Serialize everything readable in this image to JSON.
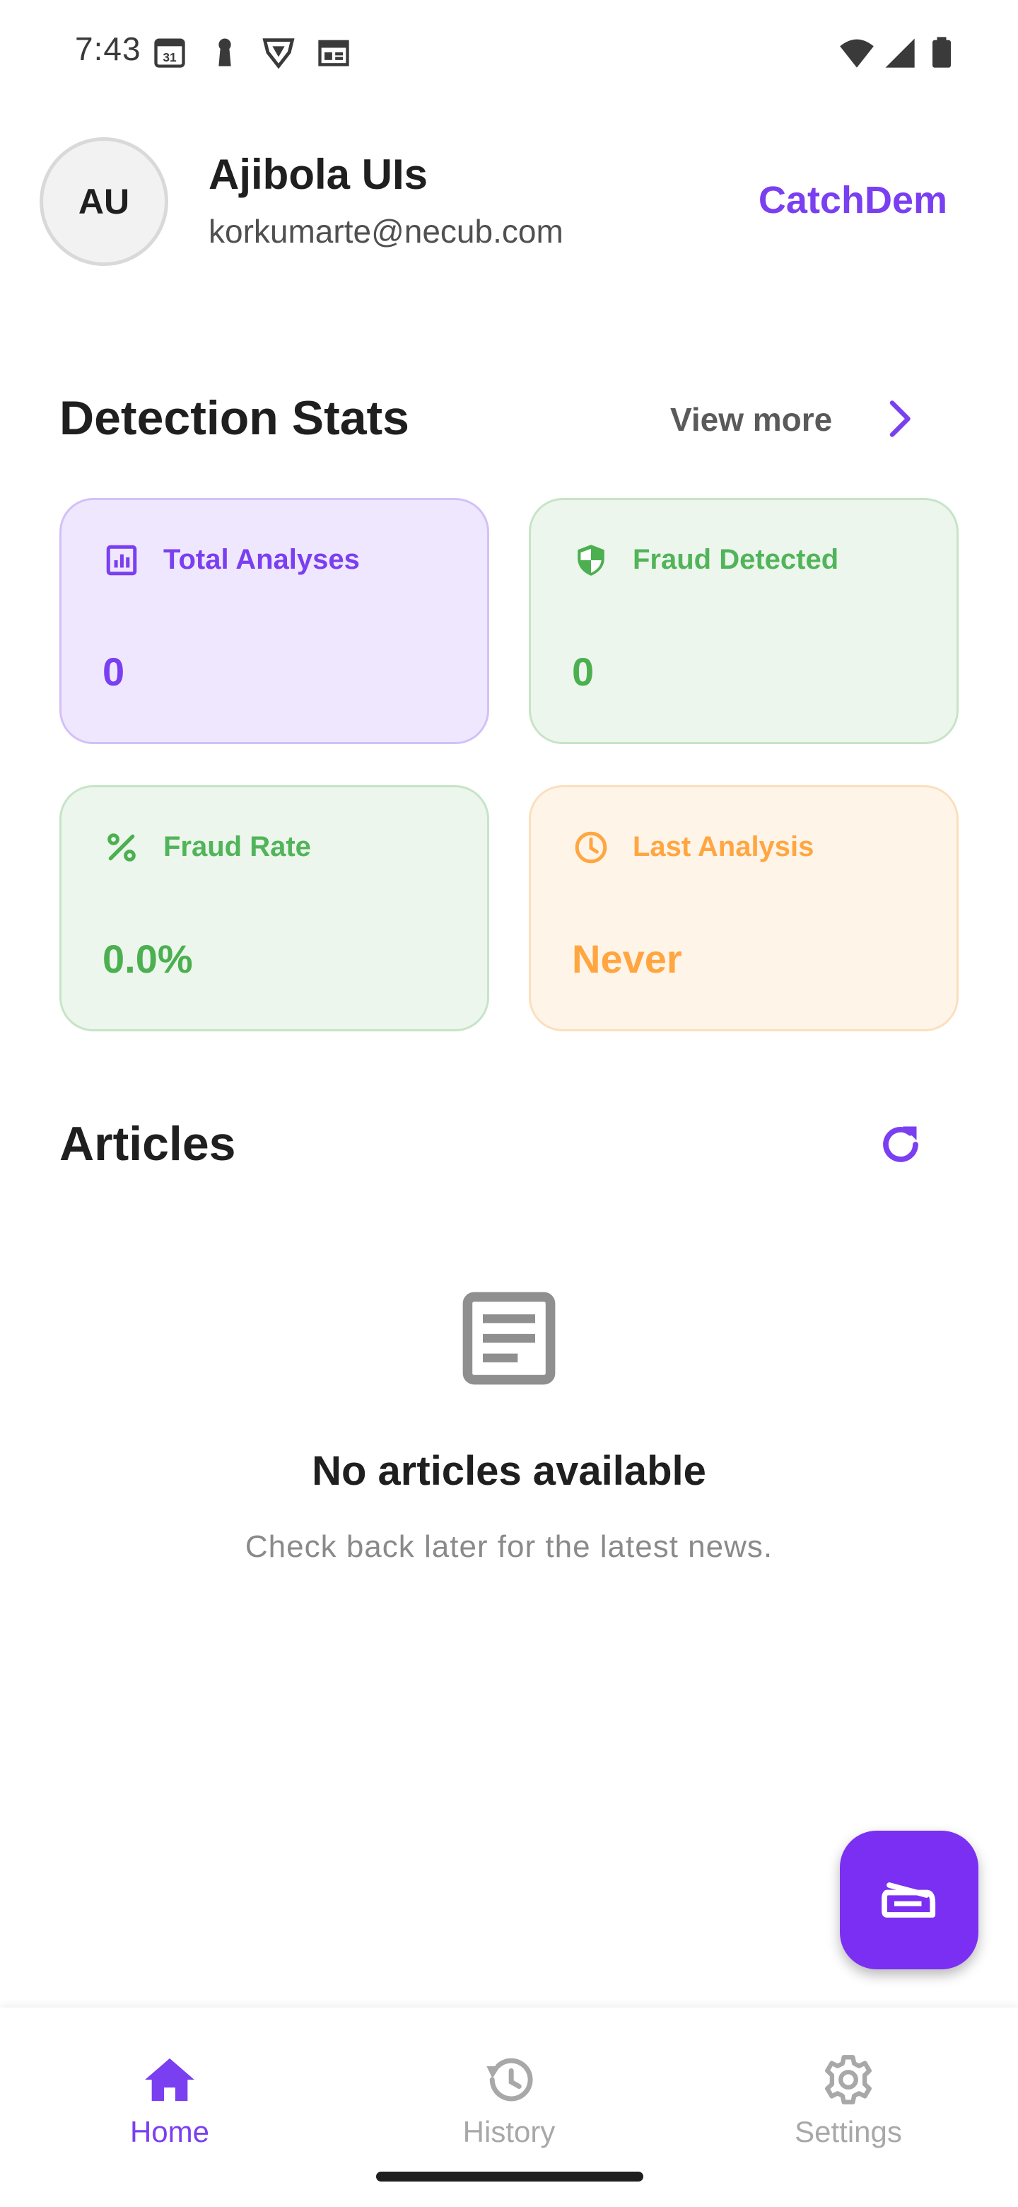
{
  "status_bar": {
    "time": "7:43",
    "left_icons": [
      "calendar-31-icon",
      "keyhole-icon",
      "vpn-shield-icon",
      "news-icon"
    ],
    "right_icons": [
      "wifi-icon",
      "signal-icon",
      "battery-icon"
    ]
  },
  "header": {
    "avatar_initials": "AU",
    "user_name": "Ajibola UIs",
    "user_email": "korkumarte@necub.com",
    "brand": "CatchDem"
  },
  "stats": {
    "title": "Detection Stats",
    "view_more": "View more",
    "cards": [
      {
        "label": "Total Analyses",
        "value": "0",
        "icon": "bar-chart-icon",
        "color": "#7a3ff0"
      },
      {
        "label": "Fraud Detected",
        "value": "0",
        "icon": "shield-icon",
        "color": "#4caf50"
      },
      {
        "label": "Fraud Rate",
        "value": "0.0%",
        "icon": "percent-icon",
        "color": "#4caf50"
      },
      {
        "label": "Last Analysis",
        "value": "Never",
        "icon": "clock-icon",
        "color": "#ffa640"
      }
    ]
  },
  "articles": {
    "title": "Articles",
    "empty_title": "No articles available",
    "empty_subtitle": "Check back later for the latest news."
  },
  "fab": {
    "icon": "scanner-icon"
  },
  "bottom_nav": {
    "items": [
      {
        "label": "Home",
        "icon": "home-icon",
        "active": true
      },
      {
        "label": "History",
        "icon": "history-icon",
        "active": false
      },
      {
        "label": "Settings",
        "icon": "settings-icon",
        "active": false
      }
    ]
  },
  "colors": {
    "accent": "#7a3ff0",
    "fab": "#7b2ff2",
    "green": "#4caf50",
    "orange": "#ffa640"
  }
}
